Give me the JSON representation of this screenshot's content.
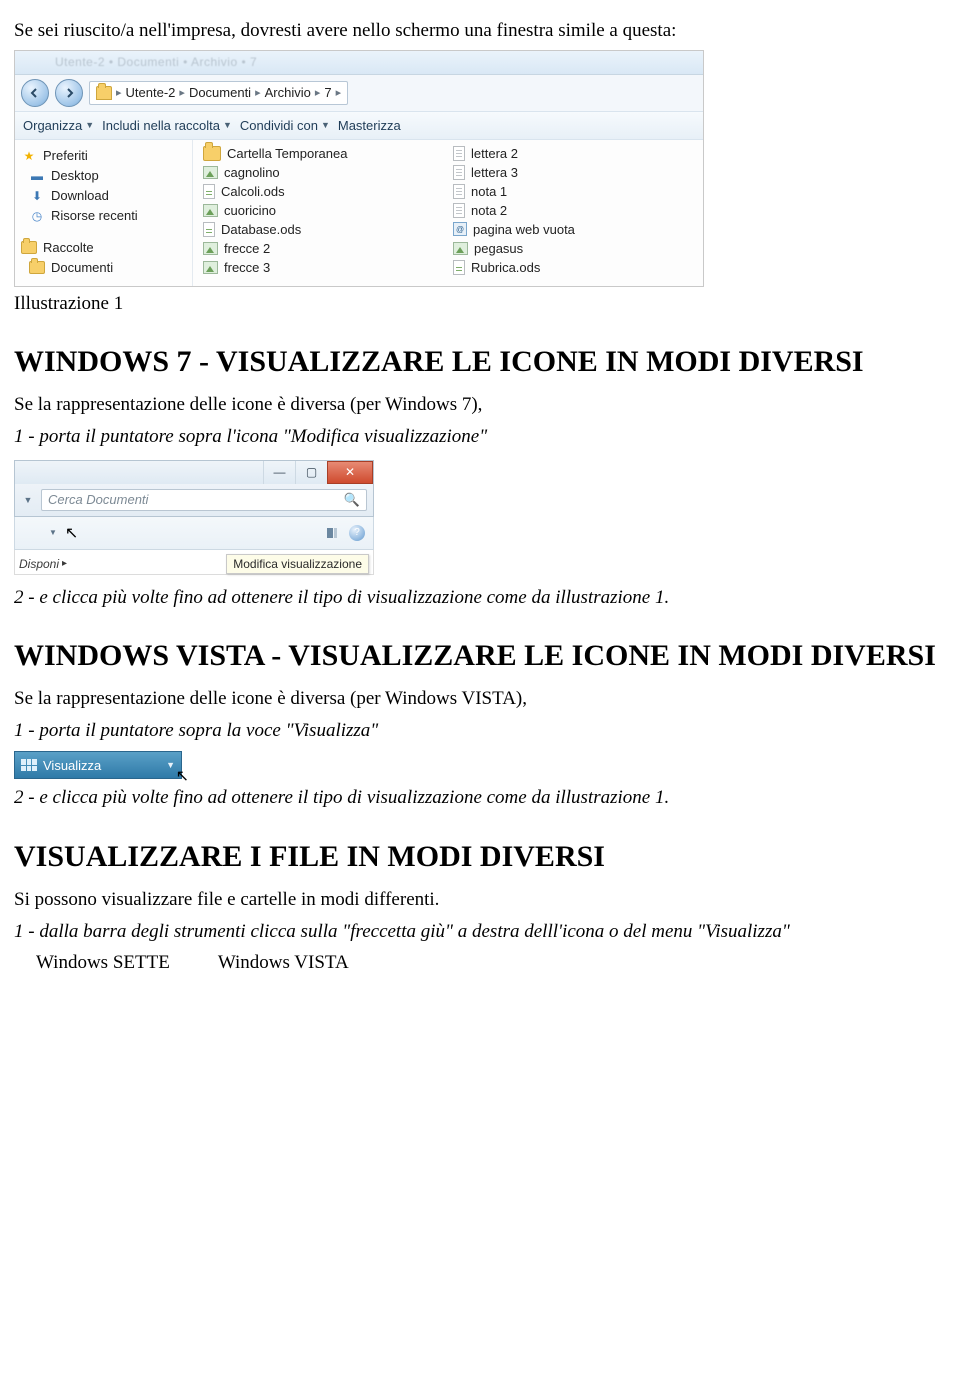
{
  "intro": "Se sei riuscito/a nell'impresa, dovresti avere nello schermo una finestra simile a questa:",
  "shot1": {
    "titlebar_blur": "Utente-2 • Documenti • Archivio • 7",
    "breadcrumb": [
      "Utente-2",
      "Documenti",
      "Archivio",
      "7"
    ],
    "toolbar": {
      "organize": "Organizza",
      "include": "Includi nella raccolta",
      "share": "Condividi con",
      "burn": "Masterizza"
    },
    "sidebar": {
      "fav_header": "Preferiti",
      "fav_items": [
        "Desktop",
        "Download",
        "Risorse recenti"
      ],
      "lib_header": "Raccolte",
      "lib_items": [
        "Documenti"
      ]
    },
    "col1": [
      "Cartella Temporanea",
      "cagnolino",
      "Calcoli.ods",
      "cuoricino",
      "Database.ods",
      "frecce 2",
      "frecce 3"
    ],
    "col2": [
      "lettera 2",
      "lettera 3",
      "nota 1",
      "nota 2",
      "pagina web vuota",
      "pegasus",
      "Rubrica.ods"
    ]
  },
  "caption1": "Illustrazione 1",
  "h1": "WINDOWS 7 - VISUALIZZARE LE ICONE IN MODI DIVERSI",
  "p1": "Se la rappresentazione delle icone è diversa (per Windows 7),",
  "p1i": "1 - porta il puntatore sopra l'icona \"Modifica visualizzazione\"",
  "shot2": {
    "search_placeholder": "Cerca Documenti",
    "disponi": "Disponi",
    "tooltip": "Modifica visualizzazione"
  },
  "p2i": "2 - e clicca più volte fino ad ottenere il tipo di visualizzazione come da illustrazione 1.",
  "h2": "WINDOWS VISTA - VISUALIZZARE LE ICONE IN MODI DIVERSI",
  "p3": "Se la rappresentazione delle icone è diversa (per Windows VISTA),",
  "p3i": "1 - porta il puntatore sopra la voce \"Visualizza\"",
  "shot3": {
    "label": "Visualizza"
  },
  "p4i": "2 - e clicca più volte fino ad ottenere il tipo di visualizzazione come da illustrazione 1.",
  "h3": "VISUALIZZARE I FILE IN MODI DIVERSI",
  "p5": "Si possono visualizzare file e cartelle in modi differenti.",
  "p5i": "1 - dalla barra degli strumenti clicca sulla \"freccetta giù\" a destra delll'icona o del menu \"Visualizza\"",
  "footer": {
    "left": "Windows SETTE",
    "right": "Windows VISTA"
  }
}
